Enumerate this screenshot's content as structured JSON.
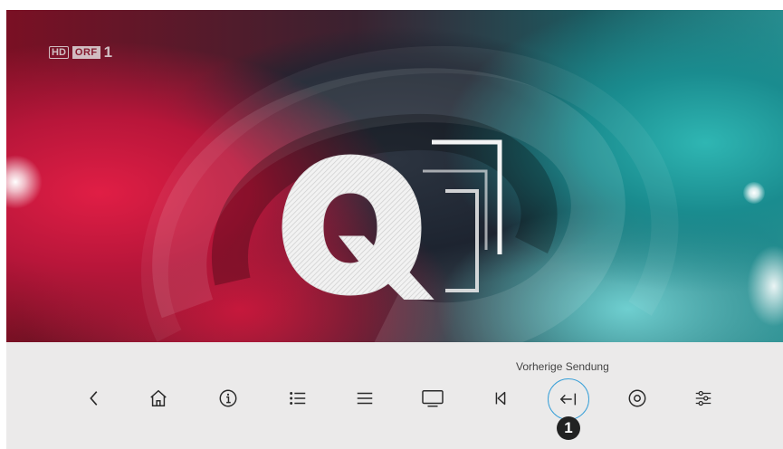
{
  "channel": {
    "hd_label": "HD",
    "name": "ORF",
    "number": "1"
  },
  "tooltip": {
    "text": "Vorherige Sendung"
  },
  "controls": [
    {
      "name": "back-icon"
    },
    {
      "name": "home-icon"
    },
    {
      "name": "info-icon"
    },
    {
      "name": "list-icon"
    },
    {
      "name": "menu-icon"
    },
    {
      "name": "tv-icon"
    },
    {
      "name": "skip-back-icon"
    },
    {
      "name": "previous-show-icon",
      "selected": true
    },
    {
      "name": "record-icon"
    },
    {
      "name": "settings-sliders-icon"
    }
  ],
  "marker": {
    "label": "1"
  },
  "colors": {
    "bar_bg": "#ebeaea",
    "focus_ring": "#3aa0d8",
    "icon": "#2a2a2a"
  }
}
